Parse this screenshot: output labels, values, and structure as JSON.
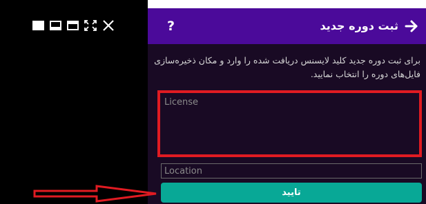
{
  "window_controls": {
    "icons": [
      "fullscreen-icon",
      "dock-bottom-icon",
      "dock-top-icon",
      "expand-icon",
      "close-icon"
    ]
  },
  "header": {
    "title": "ثبت دوره جدید",
    "help_label": "?",
    "back_icon": "arrow-right-icon",
    "background": "#4b0a9a"
  },
  "description": "برای ثبت دوره جدید کلید لایسنس دریافت شده را وارد و مکان ذخیره‌سازی فایل‌های دوره را انتخاب نمایید.",
  "form": {
    "license_placeholder": "License",
    "location_placeholder": "Location",
    "confirm_label": "تایید",
    "confirm_color": "#08a896"
  },
  "annotations": {
    "highlight_color": "#e01b22"
  }
}
